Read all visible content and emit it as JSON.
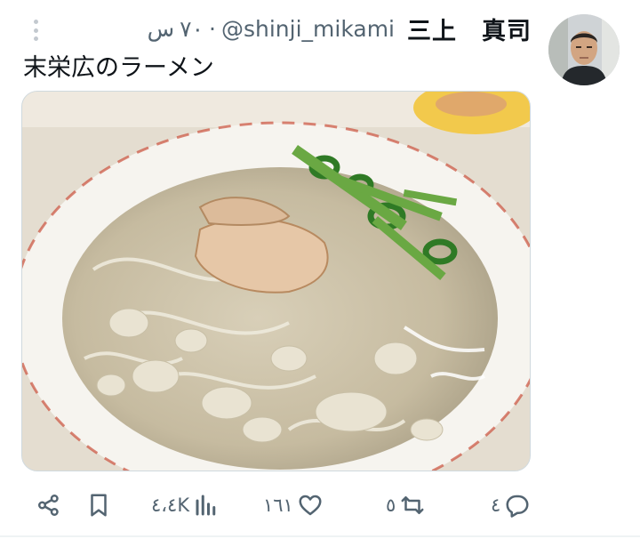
{
  "tweet": {
    "display_name": "三上　真司",
    "handle": "@shinji_mikami",
    "time_ago": "٧٠",
    "time_unit": "س",
    "text": "末栄広のラーメン"
  },
  "actions": {
    "replies": "٤",
    "retweets": "٥",
    "likes": "١٦١",
    "views": "٤،٤K"
  },
  "icons": {
    "more": "more-vertical-icon",
    "reply": "reply-bubble-icon",
    "retweet": "retweet-icon",
    "like": "heart-icon",
    "views": "bar-chart-icon",
    "bookmark": "bookmark-icon",
    "share": "share-icon"
  },
  "colors": {
    "text_primary": "#0f1419",
    "text_secondary": "#536471",
    "icon_gray": "#536471",
    "divider": "#eff3f4"
  }
}
